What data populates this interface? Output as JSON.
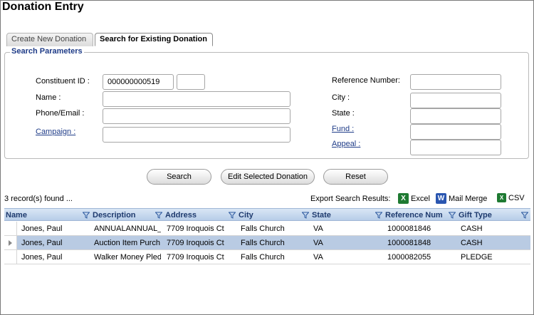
{
  "page": {
    "title": "Donation Entry"
  },
  "tabs": [
    {
      "label": "Create New Donation",
      "active": false
    },
    {
      "label": "Search for Existing Donation",
      "active": true
    }
  ],
  "search_params": {
    "legend": "Search Parameters",
    "constituent_id": {
      "label": "Constituent ID :",
      "value": "000000000519",
      "extra_value": ""
    },
    "name": {
      "label": "Name :",
      "value": ""
    },
    "phone_email": {
      "label": "Phone/Email :",
      "value": ""
    },
    "campaign": {
      "label": "Campaign :",
      "value": ""
    },
    "reference_number": {
      "label": "Reference Number:",
      "value": ""
    },
    "city": {
      "label": "City :",
      "value": ""
    },
    "state": {
      "label": "State :",
      "value": ""
    },
    "fund": {
      "label": "Fund :",
      "value": ""
    },
    "appeal": {
      "label": "Appeal :",
      "value": ""
    }
  },
  "actions": {
    "search": "Search",
    "edit_selected": "Edit Selected Donation",
    "reset": "Reset"
  },
  "results": {
    "found_text": "3 record(s) found ...",
    "export_label": "Export Search Results:",
    "export_excel": "Excel",
    "export_mail_merge": "Mail Merge",
    "export_csv": "CSV",
    "columns": [
      "Name",
      "Description",
      "Address",
      "City",
      "State",
      "Reference Num",
      "Gift Type"
    ],
    "rows": [
      {
        "name": "Jones, Paul",
        "description": "ANNUALANNUAL_",
        "address": "7709 Iroquois Ct",
        "city": "Falls Church",
        "state": "VA",
        "reference": "1000081846",
        "gift_type": "CASH",
        "selected": false
      },
      {
        "name": "Jones, Paul",
        "description": "Auction Item Purch",
        "address": "7709 Iroquois Ct",
        "city": "Falls Church",
        "state": "VA",
        "reference": "1000081848",
        "gift_type": "CASH",
        "selected": true
      },
      {
        "name": "Jones, Paul",
        "description": "Walker Money Pled",
        "address": "7709 Iroquois Ct",
        "city": "Falls Church",
        "state": "VA",
        "reference": "1000082055",
        "gift_type": "PLEDGE",
        "selected": false
      }
    ]
  },
  "colors": {
    "link": "#1f3c88",
    "header_bg": "#c8d9ee",
    "selected_row": "#b9cbe3",
    "excel_icon": "#1e7a32",
    "word_icon": "#2a56b0"
  },
  "icons": {
    "filter": "filter-funnel-icon",
    "excel": "excel-icon",
    "mail_merge": "word-icon",
    "csv": "csv-icon"
  }
}
